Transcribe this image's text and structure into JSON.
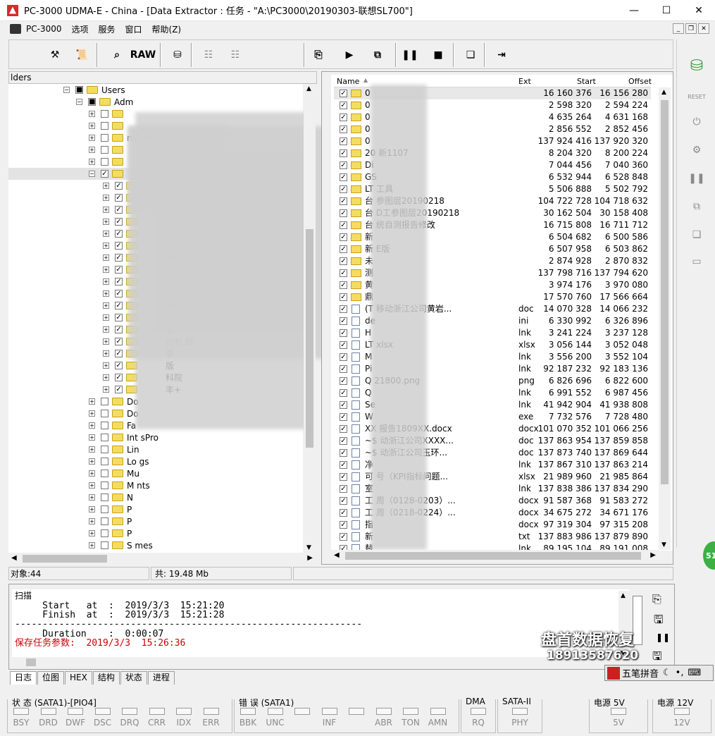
{
  "window": {
    "title": "PC-3000 UDMA-E - China - [Data Extractor : 任务 - \"A:\\PC3000\\20190303-联想SL700\"]",
    "minimize": "—",
    "maximize": "☐",
    "close": "✕"
  },
  "menu": [
    "PC-3000",
    "选项",
    "服务",
    "窗口",
    "帮助(Z)"
  ],
  "toolbar": {
    "raw_label": "RAW"
  },
  "left_panel": {
    "header": "lders"
  },
  "tree": [
    {
      "label": "Users",
      "indent": 0,
      "exp": "−",
      "chk": "■"
    },
    {
      "label": "Adm",
      "indent": 1,
      "exp": "−",
      "chk": "■"
    },
    {
      "label": "",
      "indent": 2,
      "exp": "+",
      "chk": ""
    },
    {
      "label": "",
      "indent": 2,
      "exp": "+",
      "chk": ""
    },
    {
      "label": "n Data",
      "indent": 2,
      "exp": "+",
      "chk": ""
    },
    {
      "label": "",
      "indent": 2,
      "exp": "+",
      "chk": ""
    },
    {
      "label": "",
      "indent": 2,
      "exp": "+",
      "chk": ""
    },
    {
      "label": "",
      "indent": 2,
      "exp": "−",
      "chk": "✓"
    },
    {
      "label": "",
      "indent": 3,
      "exp": "+",
      "chk": "✓"
    },
    {
      "label": "",
      "indent": 3,
      "exp": "+",
      "chk": "✓"
    },
    {
      "label": "",
      "indent": 3,
      "exp": "+",
      "chk": "✓"
    },
    {
      "label": "",
      "indent": 3,
      "exp": "+",
      "chk": "✓"
    },
    {
      "label": "",
      "indent": 3,
      "exp": "+",
      "chk": "✓"
    },
    {
      "label": "鼓",
      "indent": 3,
      "exp": "+",
      "chk": "✓"
    },
    {
      "label": "eni",
      "indent": 3,
      "exp": "+",
      "chk": "✓"
    },
    {
      "label": "",
      "indent": 3,
      "exp": "+",
      "chk": "✓"
    },
    {
      "label": "分",
      "indent": 3,
      "exp": "+",
      "chk": "✓"
    },
    {
      "label": "动 90218",
      "indent": 3,
      "exp": "+",
      "chk": "✓"
    },
    {
      "label": "动 20190218",
      "indent": 3,
      "exp": "+",
      "chk": "✓"
    },
    {
      "label": "没 修改",
      "indent": 3,
      "exp": "+",
      "chk": "✓"
    },
    {
      "label": "牛",
      "indent": 3,
      "exp": "+",
      "chk": "✓"
    },
    {
      "label": "台和 版",
      "indent": 3,
      "exp": "+",
      "chk": "✓"
    },
    {
      "label": "事",
      "indent": 3,
      "exp": "+",
      "chk": "✓"
    },
    {
      "label": "版",
      "indent": 3,
      "exp": "+",
      "chk": "✓"
    },
    {
      "label": "科院",
      "indent": 3,
      "exp": "+",
      "chk": "✓"
    },
    {
      "label": "丰+",
      "indent": 3,
      "exp": "+",
      "chk": "✓"
    },
    {
      "label": "Do",
      "indent": 2,
      "exp": "+",
      "chk": ""
    },
    {
      "label": "Do",
      "indent": 2,
      "exp": "+",
      "chk": ""
    },
    {
      "label": "Fa",
      "indent": 2,
      "exp": "+",
      "chk": ""
    },
    {
      "label": "Int sPro",
      "indent": 2,
      "exp": "+",
      "chk": ""
    },
    {
      "label": "Lin",
      "indent": 2,
      "exp": "+",
      "chk": ""
    },
    {
      "label": "Lo gs",
      "indent": 2,
      "exp": "+",
      "chk": ""
    },
    {
      "label": "Mu",
      "indent": 2,
      "exp": "+",
      "chk": ""
    },
    {
      "label": "M nts",
      "indent": 2,
      "exp": "+",
      "chk": ""
    },
    {
      "label": "N",
      "indent": 2,
      "exp": "+",
      "chk": ""
    },
    {
      "label": "P",
      "indent": 2,
      "exp": "+",
      "chk": ""
    },
    {
      "label": "P",
      "indent": 2,
      "exp": "+",
      "chk": ""
    },
    {
      "label": "P",
      "indent": 2,
      "exp": "+",
      "chk": ""
    },
    {
      "label": "S mes",
      "indent": 2,
      "exp": "+",
      "chk": ""
    }
  ],
  "file_list": {
    "columns": [
      "Name",
      "Ext",
      "Start",
      "Offset"
    ],
    "rows": [
      {
        "name": "0",
        "ext": "",
        "start": "16 160 376",
        "offset": "16 156 280",
        "type": "folder"
      },
      {
        "name": "0",
        "ext": "",
        "start": "2 598 320",
        "offset": "2 594 224",
        "type": "folder"
      },
      {
        "name": "0",
        "ext": "",
        "start": "4 635 264",
        "offset": "4 631 168",
        "type": "folder"
      },
      {
        "name": "0",
        "ext": "",
        "start": "2 856 552",
        "offset": "2 852 456",
        "type": "folder"
      },
      {
        "name": "0",
        "ext": "",
        "start": "137 924 416",
        "offset": "137 920 320",
        "type": "folder"
      },
      {
        "name": "20 新1107",
        "ext": "",
        "start": "8 204 320",
        "offset": "8 200 224",
        "type": "folder"
      },
      {
        "name": "Di",
        "ext": "",
        "start": "7 044 456",
        "offset": "7 040 360",
        "type": "folder"
      },
      {
        "name": "GS",
        "ext": "",
        "start": "6 532 944",
        "offset": "6 528 848",
        "type": "folder"
      },
      {
        "name": "LT 工具",
        "ext": "",
        "start": "5 506 888",
        "offset": "5 502 792",
        "type": "folder"
      },
      {
        "name": "台 参图层20190218",
        "ext": "",
        "start": "104 722 728",
        "offset": "104 718 632",
        "type": "folder"
      },
      {
        "name": "台 D工参图层20190218",
        "ext": "",
        "start": "30 162 504",
        "offset": "30 158 408",
        "type": "folder"
      },
      {
        "name": "台 统自测报告修改",
        "ext": "",
        "start": "16 715 808",
        "offset": "16 711 712",
        "type": "folder"
      },
      {
        "name": "新",
        "ext": "",
        "start": "6 504 682",
        "offset": "6 500 586",
        "type": "folder"
      },
      {
        "name": "新 E版",
        "ext": "",
        "start": "6 507 958",
        "offset": "6 503 862",
        "type": "folder"
      },
      {
        "name": "未",
        "ext": "",
        "start": "2 874 928",
        "offset": "2 870 832",
        "type": "folder"
      },
      {
        "name": "测",
        "ext": "",
        "start": "137 798 716",
        "offset": "137 794 620",
        "type": "folder"
      },
      {
        "name": "黄",
        "ext": "",
        "start": "3 974 176",
        "offset": "3 970 080",
        "type": "folder"
      },
      {
        "name": "鼎",
        "ext": "",
        "start": "17 570 760",
        "offset": "17 566 664",
        "type": "folder"
      },
      {
        "name": "(T 移动浙江公司黄岩...",
        "ext": "doc",
        "start": "14 070 328",
        "offset": "14 066 232",
        "type": "file"
      },
      {
        "name": "de",
        "ext": "ini",
        "start": "6 330 992",
        "offset": "6 326 896",
        "type": "file"
      },
      {
        "name": "H",
        "ext": "lnk",
        "start": "3 241 224",
        "offset": "3 237 128",
        "type": "file"
      },
      {
        "name": "LT xlsx",
        "ext": "xlsx",
        "start": "3 056 144",
        "offset": "3 052 048",
        "type": "file"
      },
      {
        "name": "M",
        "ext": "lnk",
        "start": "3 556 200",
        "offset": "3 552 104",
        "type": "file"
      },
      {
        "name": "Pi",
        "ext": "lnk",
        "start": "92 187 232",
        "offset": "92 183 136",
        "type": "file"
      },
      {
        "name": "Q 21800.png",
        "ext": "png",
        "start": "6 826 696",
        "offset": "6 822 600",
        "type": "file"
      },
      {
        "name": "Q",
        "ext": "lnk",
        "start": "6 991 552",
        "offset": "6 987 456",
        "type": "file"
      },
      {
        "name": "Se",
        "ext": "lnk",
        "start": "41 942 904",
        "offset": "41 938 808",
        "type": "file"
      },
      {
        "name": "W",
        "ext": "exe",
        "start": "7 732 576",
        "offset": "7 728 480",
        "type": "file"
      },
      {
        "name": "XX 报告1809XX.docx",
        "ext": "docx",
        "start": "101 070 352",
        "offset": "101 066 256",
        "type": "file"
      },
      {
        "name": "~$ 动浙江公司XXXX...",
        "ext": "doc",
        "start": "137 863 954",
        "offset": "137 859 858",
        "type": "file"
      },
      {
        "name": "~$ 动浙江公司玉环...",
        "ext": "doc",
        "start": "137 873 740",
        "offset": "137 869 644",
        "type": "file"
      },
      {
        "name": "净",
        "ext": "lnk",
        "start": "137 867 310",
        "offset": "137 863 214",
        "type": "file"
      },
      {
        "name": "可 号（KPI指标问题...",
        "ext": "xlsx",
        "start": "21 989 960",
        "offset": "21 985 864",
        "type": "file"
      },
      {
        "name": "室",
        "ext": "lnk",
        "start": "137 838 386",
        "offset": "137 834 290",
        "type": "file"
      },
      {
        "name": "工 周（0128-0203）...",
        "ext": "docx",
        "start": "91 587 368",
        "offset": "91 583 272",
        "type": "file"
      },
      {
        "name": "工 周（0218-0224）...",
        "ext": "docx",
        "start": "34 675 272",
        "offset": "34 671 176",
        "type": "file"
      },
      {
        "name": "指",
        "ext": "docx",
        "start": "97 319 304",
        "offset": "97 315 208",
        "type": "file"
      },
      {
        "name": "新",
        "ext": "txt",
        "start": "137 883 986",
        "offset": "137 879 890",
        "type": "file"
      },
      {
        "name": "替",
        "ext": "lnk",
        "start": "89 195 104",
        "offset": "89 191 008",
        "type": "file"
      }
    ]
  },
  "status_mid": {
    "objects": "对象:44",
    "total": "共: 19.48 Mb"
  },
  "log": {
    "title": "扫描",
    "start": "     Start   at  :  2019/3/3  15:21:20",
    "finish": "     Finish  at  :  2019/3/3  15:21:28",
    "dashes": "---------------------------------------------------------------",
    "duration": "     Duration    :  0:00:07",
    "saved": "保存任务参数:  2019/3/3  15:26:36"
  },
  "tabs": [
    "日志",
    "位图",
    "HEX",
    "结构",
    "状态",
    "进程"
  ],
  "status_groups": [
    {
      "title": "状 态 (SATA1)-[PIO4]",
      "leds": [
        "BSY",
        "DRD",
        "DWF",
        "DSC",
        "DRQ",
        "CRR",
        "IDX",
        "ERR"
      ]
    },
    {
      "title": "错 误 (SATA1)",
      "leds": [
        "BBK",
        "UNC",
        "",
        "INF",
        "",
        "ABR",
        "TON",
        "AMN"
      ]
    },
    {
      "title": "DMA",
      "leds": [
        "RQ"
      ]
    },
    {
      "title": "SATA-II",
      "leds": [
        "PHY"
      ]
    },
    {
      "title": "电源 5V",
      "leds": [
        "5V"
      ]
    },
    {
      "title": "电源 12V",
      "leds": [
        "12V"
      ]
    }
  ],
  "watermark": {
    "line1": "盘首数据恢复",
    "line2": "18913587620"
  },
  "ime": {
    "label": "五笔拼音"
  },
  "green_badge": "51",
  "colors": {
    "log_red": "#cc0000",
    "folder": "#f3dd60",
    "selection": "#e8e8e8"
  }
}
